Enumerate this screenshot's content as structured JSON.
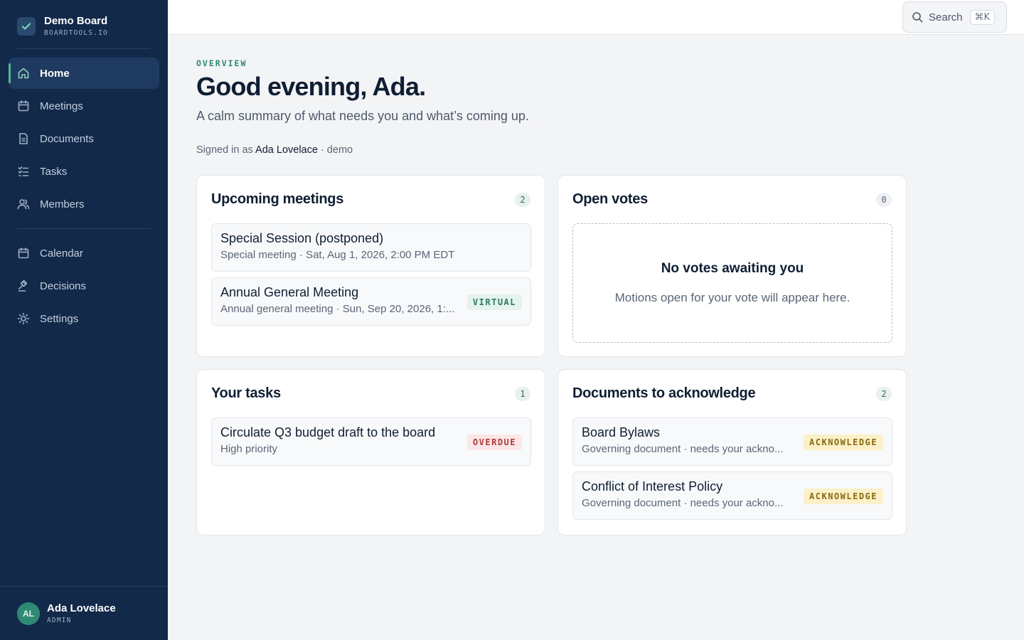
{
  "brand": {
    "name": "Demo Board",
    "sub": "BOARDTOOLS.IO"
  },
  "nav": {
    "primary": [
      {
        "label": "Home",
        "icon": "home-icon",
        "active": true
      },
      {
        "label": "Meetings",
        "icon": "calendar-icon"
      },
      {
        "label": "Documents",
        "icon": "document-icon"
      },
      {
        "label": "Tasks",
        "icon": "tasks-icon"
      },
      {
        "label": "Members",
        "icon": "members-icon"
      }
    ],
    "secondary": [
      {
        "label": "Calendar",
        "icon": "calendar-icon"
      },
      {
        "label": "Decisions",
        "icon": "gavel-icon"
      },
      {
        "label": "Settings",
        "icon": "sun-icon"
      }
    ]
  },
  "user": {
    "initials": "AL",
    "name": "Ada Lovelace",
    "role": "ADMIN"
  },
  "search": {
    "label": "Search",
    "shortcut": "⌘K"
  },
  "header": {
    "eyebrow": "OVERVIEW",
    "title": "Good evening, Ada.",
    "subtitle": "A calm summary of what needs you and what’s coming up.",
    "signed_prefix": "Signed in as",
    "signed_name": "Ada Lovelace",
    "signed_suffix": "· demo"
  },
  "meetings": {
    "title": "Upcoming meetings",
    "count": "2",
    "items": [
      {
        "title": "Special Session (postponed)",
        "sub": "Special meeting · Sat, Aug 1, 2026, 2:00 PM EDT"
      },
      {
        "title": "Annual General Meeting",
        "sub": "Annual general meeting · Sun, Sep 20, 2026, 1:...",
        "tag": "VIRTUAL"
      }
    ]
  },
  "votes": {
    "title": "Open votes",
    "count": "0",
    "empty_title": "No votes awaiting you",
    "empty_sub": "Motions open for your vote will appear here."
  },
  "tasks": {
    "title": "Your tasks",
    "count": "1",
    "items": [
      {
        "title": "Circulate Q3 budget draft to the board",
        "sub": "High priority",
        "tag": "OVERDUE"
      }
    ]
  },
  "documents": {
    "title": "Documents to acknowledge",
    "count": "2",
    "items": [
      {
        "title": "Board Bylaws",
        "sub": "Governing document · needs your ackno...",
        "tag": "ACKNOWLEDGE"
      },
      {
        "title": "Conflict of Interest Policy",
        "sub": "Governing document · needs your ackno...",
        "tag": "ACKNOWLEDGE"
      }
    ]
  },
  "colors": {
    "sidebar": "#13294a",
    "accent": "#2e8a73",
    "overdue": "#b23a3a",
    "acknowledge": "#8a6a10"
  }
}
